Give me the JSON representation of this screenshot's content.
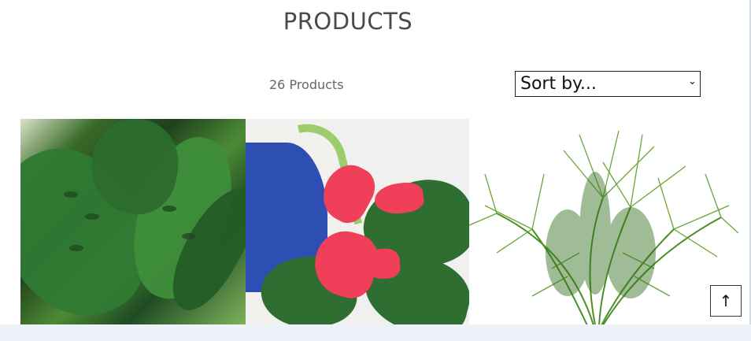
{
  "header": {
    "title": "PRODUCTS"
  },
  "listing": {
    "count": "26 Products",
    "sort": {
      "selected": "Sort by...",
      "options": [
        "Sort by..."
      ]
    }
  },
  "products": [
    {
      "image_name": "monstera-product-image"
    },
    {
      "image_name": "anthurium-product-image"
    },
    {
      "image_name": "palm-product-image"
    }
  ],
  "controls": {
    "back_to_top_icon": "↑"
  },
  "colors": {
    "title": "#4a4a4a",
    "footer_bar": "#edf1f8",
    "select_border": "#222222"
  }
}
